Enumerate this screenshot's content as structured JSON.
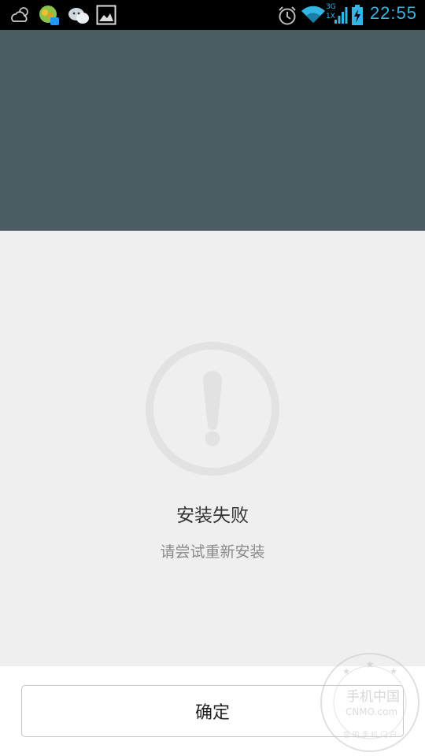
{
  "status_bar": {
    "time": "22:55",
    "network_type_top": "3G",
    "network_type_bottom": "1X",
    "accent_color": "#33b5e5",
    "icons": [
      "weather-icon",
      "app-notification-icon",
      "wechat-icon",
      "gallery-icon",
      "alarm-icon",
      "wifi-icon",
      "signal-icon",
      "battery-charging-icon"
    ]
  },
  "dialog": {
    "status_icon": "warning-icon",
    "title": "安装失败",
    "message": "请尝试重新安装",
    "confirm_label": "确定"
  },
  "colors": {
    "header": "#4b5c63",
    "content": "#efefef",
    "icon": "#e2e2e2"
  },
  "watermark": {
    "text": "手机中国",
    "domain": "CNMO.com",
    "slogan": "您 的 手 机 门 户"
  }
}
